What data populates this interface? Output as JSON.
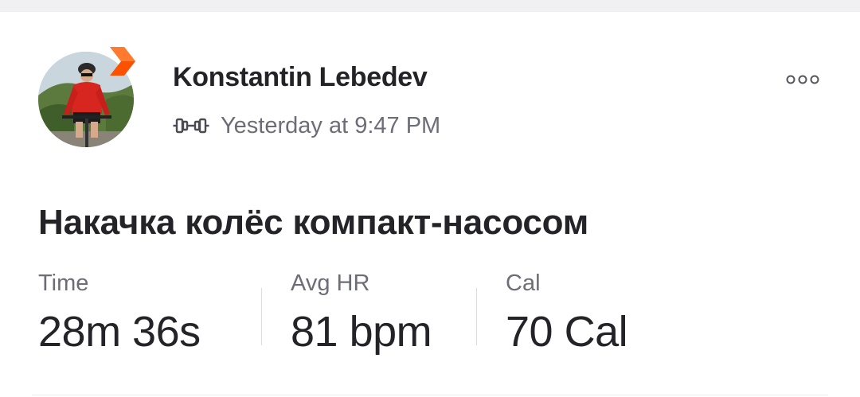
{
  "athlete": {
    "name": "Konstantin Lebedev",
    "avatar_icon": "avatar-cyclist",
    "badge_icon": "subscriber-chevron-icon",
    "badge_color": "#fc5200"
  },
  "activity": {
    "type_icon": "dumbbell-icon",
    "timestamp": "Yesterday at 9:47 PM",
    "title": "Накачка колёс компакт-насосом"
  },
  "menu": {
    "icon": "more-options-icon"
  },
  "stats": {
    "time": {
      "label": "Time",
      "value": "28m 36s"
    },
    "avg_hr": {
      "label": "Avg HR",
      "value": "81 bpm"
    },
    "calories": {
      "label": "Cal",
      "value": "70 Cal"
    }
  },
  "colors": {
    "text_primary": "#242428",
    "text_secondary": "#6d6d78",
    "brand": "#fc5200"
  }
}
